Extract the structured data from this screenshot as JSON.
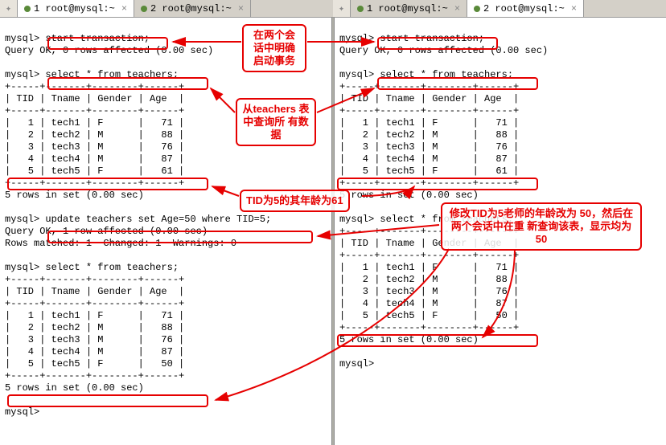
{
  "tabs": {
    "left": [
      {
        "label": "1 root@mysql:~",
        "active": true
      },
      {
        "label": "2 root@mysql:~",
        "active": false
      }
    ],
    "right": [
      {
        "label": "1 root@mysql:~",
        "active": false
      },
      {
        "label": "2 root@mysql:~",
        "active": true
      }
    ]
  },
  "prompt": "mysql>",
  "cmds": {
    "start_tx": "start transaction;",
    "query_ok": "Query OK, 0 rows affected (0.00 sec)",
    "select": "select * from teachers;",
    "update": "update teachers set Age=50 where TID=5;",
    "query_ok_1": "Query OK, 1 row affected (0.00 sec)",
    "rows_matched": "Rows matched: 1  Changed: 1  Warnings: 0",
    "rows5": "5 rows in set (0.00 sec)",
    "select_trunc": "select * from teachers;"
  },
  "table": {
    "headers": [
      "TID",
      "Tname",
      "Gender",
      "Age"
    ],
    "sep": "+-----+-------+--------+------+",
    "rows_before": [
      [
        "1",
        "tech1",
        "F",
        "71"
      ],
      [
        "2",
        "tech2",
        "M",
        "88"
      ],
      [
        "3",
        "tech3",
        "M",
        "76"
      ],
      [
        "4",
        "tech4",
        "M",
        "87"
      ],
      [
        "5",
        "tech5",
        "F",
        "61"
      ]
    ],
    "rows_after": [
      [
        "1",
        "tech1",
        "F",
        "71"
      ],
      [
        "2",
        "tech2",
        "M",
        "88"
      ],
      [
        "3",
        "tech3",
        "M",
        "76"
      ],
      [
        "4",
        "tech4",
        "M",
        "87"
      ],
      [
        "5",
        "tech5",
        "F",
        "50"
      ]
    ]
  },
  "annotations": {
    "a1": "在两个会\n话中明确\n启动事务",
    "a2": "从teachers\n表中查询所\n有数据",
    "a3": "TID为5的其年龄为61",
    "a4": "修改TID为5老师的年龄改为\n50，然后在两个会话中在重\n新查询该表，显示均为50"
  }
}
